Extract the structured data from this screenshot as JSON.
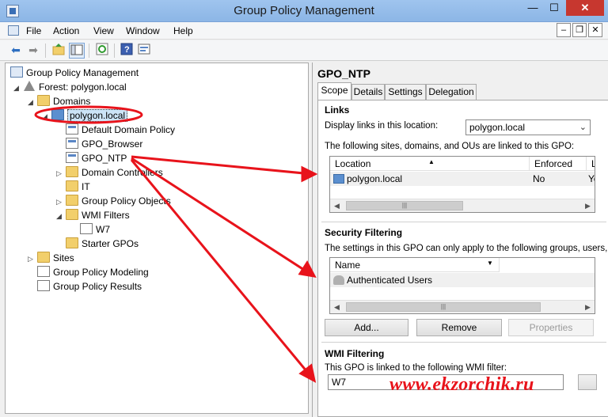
{
  "window": {
    "title": "Group Policy Management",
    "min_glyph": "—",
    "max_glyph": "☐",
    "close_glyph": "✕"
  },
  "menu": {
    "items": [
      "File",
      "Action",
      "View",
      "Window",
      "Help"
    ],
    "mdi_min": "–",
    "mdi_restore": "❐",
    "mdi_close": "✕"
  },
  "toolbar": {
    "back_glyph": "⬅",
    "forward_glyph": "➡",
    "icons": [
      "back-icon",
      "forward-icon",
      "up-folder-icon",
      "show-hide-console-tree-icon",
      "refresh-icon",
      "help-icon",
      "properties-icon"
    ]
  },
  "tree": {
    "root": "Group Policy Management",
    "forest": "Forest: polygon.local",
    "domains": "Domains",
    "domain": "polygon.local",
    "default_domain_policy": "Default Domain Policy",
    "gpo_browser": "GPO_Browser",
    "gpo_ntp": "GPO_NTP",
    "domain_controllers": "Domain Controllers",
    "it": "IT",
    "group_policy_objects": "Group Policy Objects",
    "wmi_filters": "WMI Filters",
    "w7": "W7",
    "starter_gpos": "Starter GPOs",
    "sites": "Sites",
    "modeling": "Group Policy Modeling",
    "results": "Group Policy Results"
  },
  "details": {
    "gpo_name": "GPO_NTP",
    "tabs": [
      "Scope",
      "Details",
      "Settings",
      "Delegation"
    ],
    "active_tab": "Scope",
    "links": {
      "title": "Links",
      "display_label": "Display links in this location:",
      "location_value": "polygon.local",
      "description": "The following sites, domains, and OUs are linked to this GPO:",
      "columns": [
        "Location",
        "Enforced",
        "Li"
      ],
      "rows": [
        {
          "location": "polygon.local",
          "enforced": "No",
          "link": "Ye"
        }
      ]
    },
    "security": {
      "title": "Security Filtering",
      "description": "The settings in this GPO can only apply to the following groups, users, a",
      "columns": [
        "Name"
      ],
      "rows": [
        "Authenticated Users"
      ],
      "add_label": "Add...",
      "remove_label": "Remove",
      "properties_label": "Properties"
    },
    "wmi": {
      "title": "WMI Filtering",
      "description": "This GPO is linked to the following WMI filter:",
      "value": "W7"
    }
  },
  "watermark": "www.ekzorchik.ru",
  "colors": {
    "annotation_red": "#e8131b",
    "title_bar": "#9fc4ee",
    "close_button": "#c7372f"
  }
}
